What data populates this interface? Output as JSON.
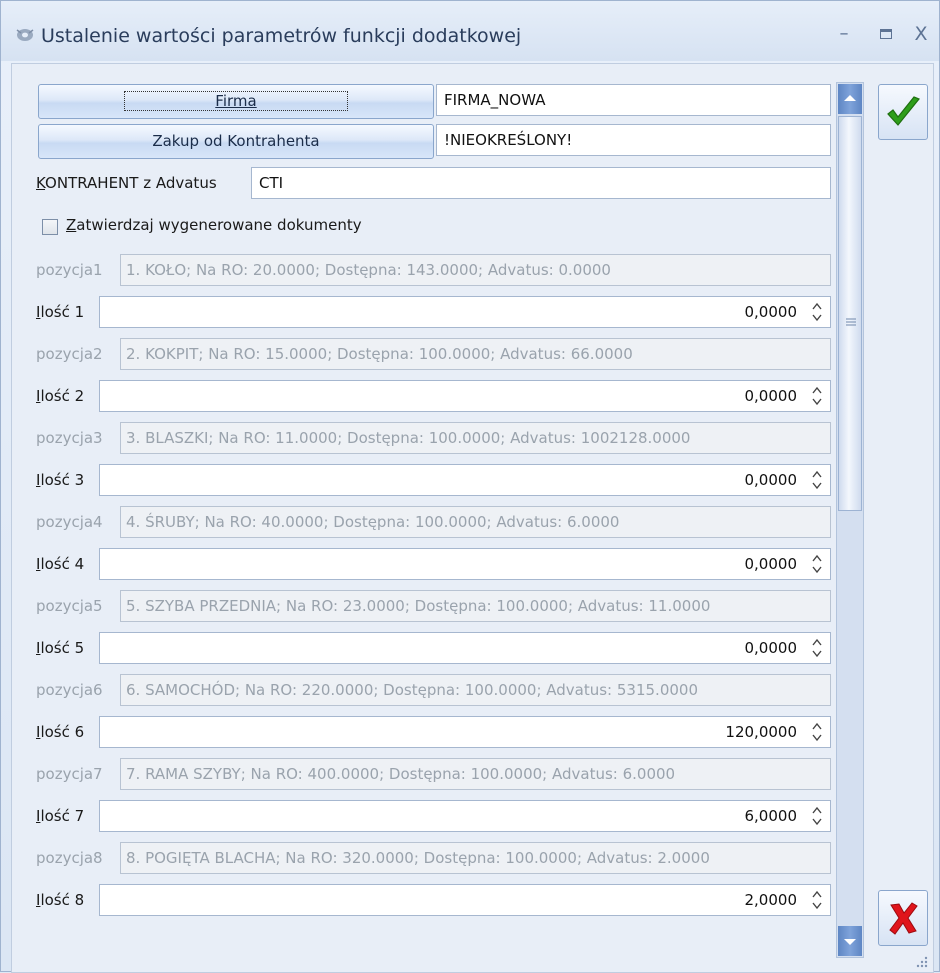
{
  "window": {
    "title": "Ustalenie wartości parametrów funkcji dodatkowej",
    "controls": {
      "minimize": "–",
      "maximize": "▪",
      "close": "X"
    }
  },
  "firma": {
    "button_label": "Firma",
    "value": "FIRMA_NOWA"
  },
  "zakup": {
    "button_label": "Zakup od Kontrahenta",
    "value": "!NIEOKREŚLONY!"
  },
  "kontrahent": {
    "label_underlined": "K",
    "label_rest": "ONTRAHENT z Advatus",
    "value": "CTI"
  },
  "checkbox": {
    "label_underlined": "Z",
    "label_rest": "atwierdzaj wygenerowane dokumenty",
    "checked": false
  },
  "rows": [
    {
      "pos_label": "pozycja1",
      "pos_value": "1. KOŁO; Na RO: 20.0000; Dostępna: 143.0000; Advatus: 0.0000",
      "qty_label": "lość 1",
      "qty_value": "0,0000"
    },
    {
      "pos_label": "pozycja2",
      "pos_value": "2. KOKPIT; Na RO: 15.0000; Dostępna: 100.0000; Advatus: 66.0000",
      "qty_label": "lość 2",
      "qty_value": "0,0000"
    },
    {
      "pos_label": "pozycja3",
      "pos_value": "3. BLASZKI; Na RO: 11.0000; Dostępna: 100.0000; Advatus: 1002128.0000",
      "qty_label": "lość 3",
      "qty_value": "0,0000"
    },
    {
      "pos_label": "pozycja4",
      "pos_value": "4. ŚRUBY; Na RO: 40.0000; Dostępna: 100.0000; Advatus: 6.0000",
      "qty_label": "lość 4",
      "qty_value": "0,0000"
    },
    {
      "pos_label": "pozycja5",
      "pos_value": "5. SZYBA PRZEDNIA; Na RO: 23.0000; Dostępna: 100.0000; Advatus: 11.0000",
      "qty_label": "lość 5",
      "qty_value": "0,0000"
    },
    {
      "pos_label": "pozycja6",
      "pos_value": "6. SAMOCHÓD; Na RO: 220.0000; Dostępna: 100.0000; Advatus: 5315.0000",
      "qty_label": "lość 6",
      "qty_value": "120,0000"
    },
    {
      "pos_label": "pozycja7",
      "pos_value": "7. RAMA SZYBY; Na RO: 400.0000; Dostępna: 100.0000; Advatus: 6.0000",
      "qty_label": "lość 7",
      "qty_value": "6,0000"
    },
    {
      "pos_label": "pozycja8",
      "pos_value": "8. POGIĘTA BLACHA; Na RO: 320.0000; Dostępna: 100.0000; Advatus: 2.0000",
      "qty_label": "lość 8",
      "qty_value": "2,0000"
    }
  ],
  "qty_label_underlined": "I",
  "icons": {
    "ok": "checkmark-icon",
    "cancel": "x-cancel-icon",
    "title": "gear-icon"
  },
  "colors": {
    "ok": "#2e9e1a",
    "cancel": "#e0141b",
    "scroll_accent": "#5e86c4"
  }
}
